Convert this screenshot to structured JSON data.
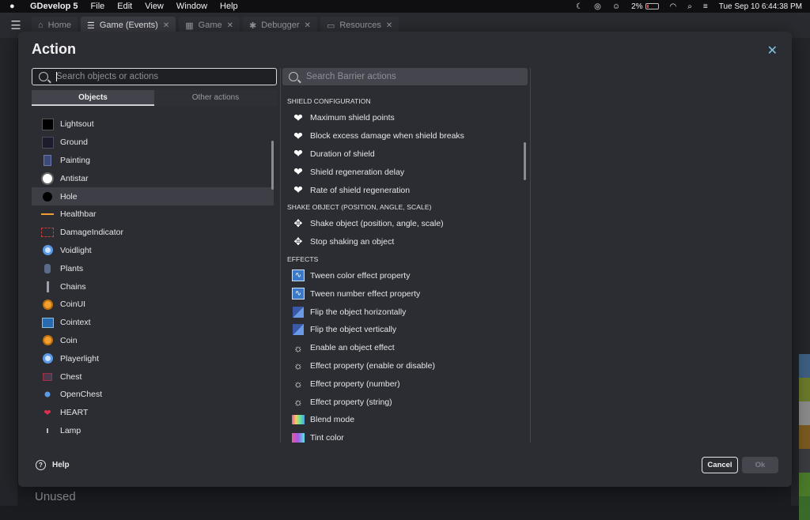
{
  "menubar": {
    "app_name": "GDevelop 5",
    "items": [
      "File",
      "Edit",
      "View",
      "Window",
      "Help"
    ],
    "battery_percent": "2%",
    "datetime": "Tue Sep 10  6:44:38 PM"
  },
  "tabs": [
    {
      "label": "Home",
      "icon": "home-icon",
      "closable": false
    },
    {
      "label": "Game (Events)",
      "icon": "events-icon",
      "closable": true,
      "active": true
    },
    {
      "label": "Game",
      "icon": "scene-icon",
      "closable": true
    },
    {
      "label": "Debugger",
      "icon": "debugger-icon",
      "closable": true
    },
    {
      "label": "Resources",
      "icon": "resources-icon",
      "closable": true
    }
  ],
  "background": {
    "unused_label": "Unused"
  },
  "dialog": {
    "title": "Action",
    "search_objects_placeholder": "Search objects or actions",
    "search_actions_placeholder": "Search Barrier actions",
    "tab_objects": "Objects",
    "tab_other": "Other actions",
    "help_label": "Help",
    "cancel_label": "Cancel",
    "ok_label": "Ok"
  },
  "objects": [
    {
      "name": "Lightsout",
      "thumb": "black-square"
    },
    {
      "name": "Ground",
      "thumb": "dark-square"
    },
    {
      "name": "Painting",
      "thumb": "painting"
    },
    {
      "name": "Antistar",
      "thumb": "white-circle"
    },
    {
      "name": "Hole",
      "thumb": "black-circle",
      "selected": true
    },
    {
      "name": "Healthbar",
      "thumb": "orange-line"
    },
    {
      "name": "DamageIndicator",
      "thumb": "red-frame"
    },
    {
      "name": "Voidlight",
      "thumb": "blue-ring"
    },
    {
      "name": "Plants",
      "thumb": "plant"
    },
    {
      "name": "Chains",
      "thumb": "chain"
    },
    {
      "name": "CoinUI",
      "thumb": "coin"
    },
    {
      "name": "Cointext",
      "thumb": "text-object"
    },
    {
      "name": "Coin",
      "thumb": "coin"
    },
    {
      "name": "Playerlight",
      "thumb": "blue-ring"
    },
    {
      "name": "Chest",
      "thumb": "chest"
    },
    {
      "name": "OpenChest",
      "thumb": "open-chest"
    },
    {
      "name": "HEART",
      "thumb": "heart"
    },
    {
      "name": "Lamp",
      "thumb": "lamp"
    }
  ],
  "action_groups": [
    {
      "header": "SHIELD CONFIGURATION",
      "items": [
        {
          "label": "Maximum shield points",
          "icon": "shield-heart-icon"
        },
        {
          "label": "Block excess damage when shield breaks",
          "icon": "shield-heart-icon"
        },
        {
          "label": "Duration of shield",
          "icon": "shield-heart-icon"
        },
        {
          "label": "Shield regeneration delay",
          "icon": "shield-heart-icon"
        },
        {
          "label": "Rate of shield regeneration",
          "icon": "shield-heart-icon"
        }
      ]
    },
    {
      "header": "SHAKE OBJECT (POSITION, ANGLE, SCALE)",
      "items": [
        {
          "label": "Shake object (position, angle, scale)",
          "icon": "move-arrows-icon"
        },
        {
          "label": "Stop shaking an object",
          "icon": "move-arrows-icon"
        }
      ]
    },
    {
      "header": "EFFECTS",
      "items": [
        {
          "label": "Tween color effect property",
          "icon": "tween-icon"
        },
        {
          "label": "Tween number effect property",
          "icon": "tween-icon"
        },
        {
          "label": "Flip the object horizontally",
          "icon": "flip-icon"
        },
        {
          "label": "Flip the object vertically",
          "icon": "flip-icon"
        },
        {
          "label": "Enable an object effect",
          "icon": "effect-sun-icon"
        },
        {
          "label": "Effect property (enable or disable)",
          "icon": "effect-sun-icon"
        },
        {
          "label": "Effect property (number)",
          "icon": "effect-sun-icon"
        },
        {
          "label": "Effect property (string)",
          "icon": "effect-sun-icon"
        },
        {
          "label": "Blend mode",
          "icon": "blend-icon"
        },
        {
          "label": "Tint color",
          "icon": "tint-icon"
        }
      ]
    }
  ],
  "colors": {
    "accent": "#7ec3e6",
    "dialog_bg": "#2c2d32",
    "selected_row": "#3e3f46"
  }
}
